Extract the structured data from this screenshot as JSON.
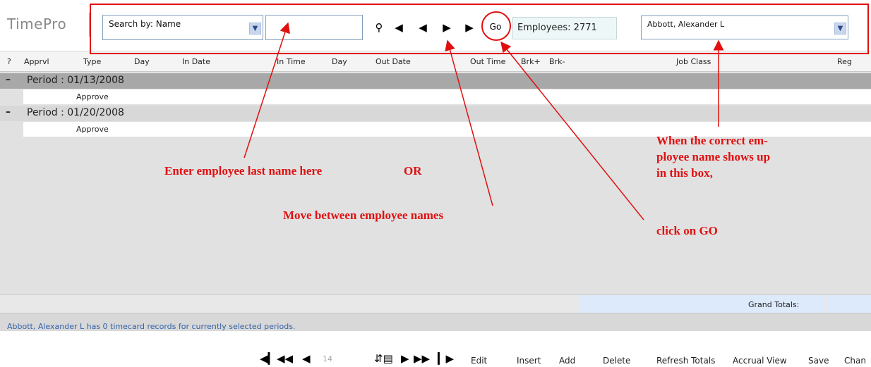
{
  "app": {
    "logo": "TimePro"
  },
  "toolbar": {
    "search_by": "Search by: Name",
    "search_value": "",
    "go_label": "Go",
    "employee_count": "Employees: 2771",
    "selected_employee": "Abbott, Alexander L"
  },
  "columns": [
    "?",
    "Apprvl",
    "Type",
    "Day",
    "In Date",
    "In Time",
    "Day",
    "Out Date",
    "Out Time",
    "Brk+",
    "Brk-",
    "Job Class",
    "Reg"
  ],
  "periods": [
    {
      "label": "Period : 01/13/2008",
      "action": "Approve"
    },
    {
      "label": "Period : 01/20/2008",
      "action": "Approve"
    }
  ],
  "totals": {
    "grand_totals_label": "Grand Totals:"
  },
  "status": {
    "message": "Abbott, Alexander L has 0 timecard records for currently selected periods."
  },
  "pager": {
    "page_number": "14"
  },
  "actions": [
    "Edit",
    "Insert",
    "Add",
    "Delete",
    "Refresh Totals",
    "Accrual View",
    "Save",
    "Chan"
  ],
  "annotations": {
    "enter_name": "Enter employee last name here",
    "or": "OR",
    "move_between": "Move between employee names",
    "when_correct": [
      "When the correct em-",
      "ployee name shows up",
      "in this box,"
    ],
    "click_go": "click on GO"
  },
  "colors": {
    "annotation": "#e01010",
    "grand_totals_bg": "#ddeafc",
    "status_text": "#3462a8"
  }
}
